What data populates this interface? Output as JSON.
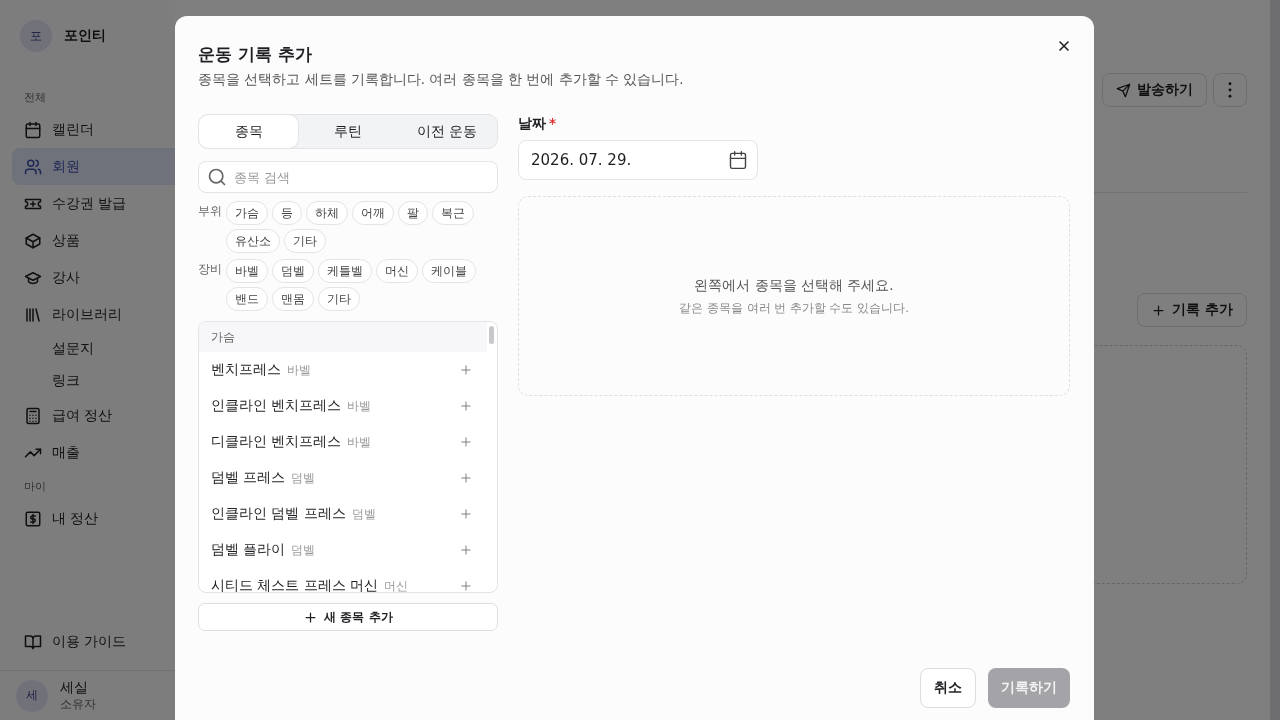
{
  "sidebar": {
    "workspace": {
      "avatar": "포",
      "name": "포인티"
    },
    "sections": [
      {
        "heading": "전체",
        "items": [
          {
            "label": "캘린더",
            "kind": "main",
            "selected": false
          },
          {
            "label": "회원",
            "kind": "main",
            "selected": true
          },
          {
            "label": "수강권 발급",
            "kind": "main",
            "selected": false
          },
          {
            "label": "상품",
            "kind": "main",
            "selected": false
          },
          {
            "label": "강사",
            "kind": "main",
            "selected": false
          },
          {
            "label": "라이브러리",
            "kind": "main",
            "selected": false
          },
          {
            "label": "설문지",
            "kind": "sub",
            "selected": false
          },
          {
            "label": "링크",
            "kind": "sub",
            "selected": false
          },
          {
            "label": "급여 정산",
            "kind": "main",
            "selected": false
          },
          {
            "label": "매출",
            "kind": "main",
            "selected": false
          }
        ]
      },
      {
        "heading": "마이",
        "items": [
          {
            "label": "내 정산",
            "kind": "main",
            "selected": false
          }
        ]
      }
    ],
    "footer_items": [
      {
        "label": "이용 가이드"
      }
    ],
    "user": {
      "avatar": "세",
      "name": "세실",
      "role": "소유자"
    }
  },
  "page": {
    "header_buttons": [
      {
        "label": "발송하기",
        "kind": "labeled"
      },
      {
        "kind": "more"
      }
    ],
    "add_record_button": "기록 추가"
  },
  "dialog": {
    "title": "운동 기록 추가",
    "description": "종목을 선택하고 세트를 기록합니다. 여러 종목을 한 번에 추가할 수 있습니다.",
    "tabs": [
      {
        "label": "종목",
        "selected": true
      },
      {
        "label": "루틴",
        "selected": false
      },
      {
        "label": "이전 운동",
        "selected": false
      }
    ],
    "search": {
      "placeholder": "종목 검색"
    },
    "filters": [
      {
        "label": "부위",
        "chips": [
          "가슴",
          "등",
          "하체",
          "어깨",
          "팔",
          "복근",
          "유산소",
          "기타"
        ]
      },
      {
        "label": "장비",
        "chips": [
          "바벨",
          "덤벨",
          "케틀벨",
          "머신",
          "케이블",
          "밴드",
          "맨몸",
          "기타"
        ]
      }
    ],
    "exercise_groups": [
      {
        "heading": "가슴",
        "items": [
          {
            "name": "벤치프레스",
            "equipment": "바벨"
          },
          {
            "name": "인클라인 벤치프레스",
            "equipment": "바벨"
          },
          {
            "name": "디클라인 벤치프레스",
            "equipment": "바벨"
          },
          {
            "name": "덤벨 프레스",
            "equipment": "덤벨"
          },
          {
            "name": "인클라인 덤벨 프레스",
            "equipment": "덤벨"
          },
          {
            "name": "덤벨 플라이",
            "equipment": "덤벨"
          },
          {
            "name": "시티드 체스트 프레스 머신",
            "equipment": "머신"
          }
        ]
      }
    ],
    "new_exercise_button": "새 종목 추가",
    "date": {
      "label": "날짜",
      "required_mark": "*",
      "value": "2026. 07. 29."
    },
    "empty_state": {
      "title": "왼쪽에서 종목을 선택해 주세요.",
      "hint": "같은 종목을 여러 번 추가할 수도 있습니다."
    },
    "buttons": [
      {
        "label": "취소",
        "kind": "secondary",
        "disabled": false
      },
      {
        "label": "기록하기",
        "kind": "primary",
        "disabled": true
      }
    ]
  }
}
